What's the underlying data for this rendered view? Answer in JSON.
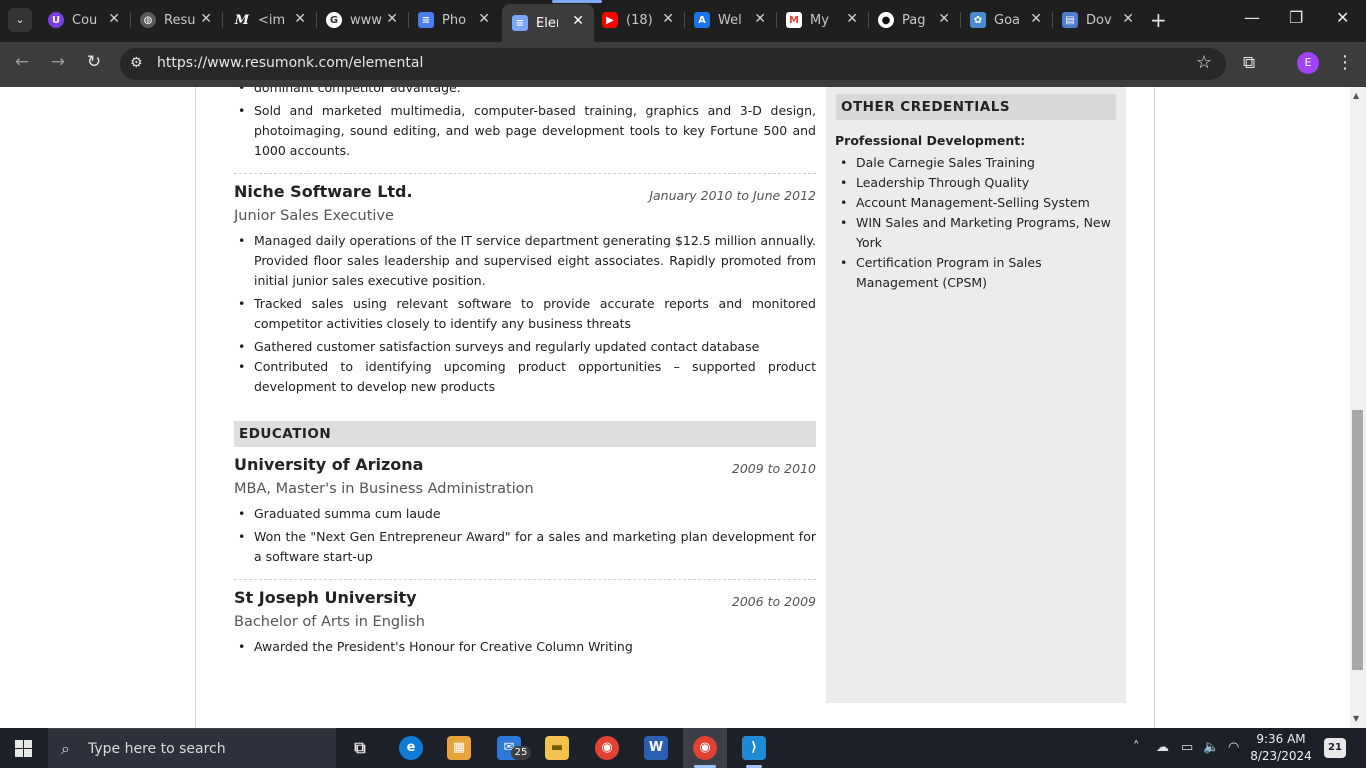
{
  "browser": {
    "tabs": [
      {
        "title": "Cou",
        "icon": "undergrad-icon",
        "color": "#7b3fe4"
      },
      {
        "title": "Resu",
        "icon": "globe-icon",
        "color": "#606060"
      },
      {
        "title": "<im",
        "icon": "medium-icon",
        "color": "#202020"
      },
      {
        "title": "www",
        "icon": "google-icon",
        "color": "#ffffff"
      },
      {
        "title": "Pho",
        "icon": "docs-icon",
        "color": "#4a7df0"
      },
      {
        "title": "Elen",
        "icon": "docs-icon",
        "color": "#7aa6ff"
      },
      {
        "title": "(18)",
        "icon": "youtube-icon",
        "color": "#ff0000"
      },
      {
        "title": "Wel",
        "icon": "docs-a-icon",
        "color": "#1a73e8"
      },
      {
        "title": "My",
        "icon": "gmail-icon",
        "color": "#ea4335"
      },
      {
        "title": "Pag",
        "icon": "github-icon",
        "color": "#ffffff"
      },
      {
        "title": "Goa",
        "icon": "goa-icon",
        "color": "#4a8ad0"
      },
      {
        "title": "Dov",
        "icon": "notepad-icon",
        "color": "#4f7ecf"
      }
    ],
    "active_tab_index": 5,
    "url": "https://www.resumonk.com/elemental",
    "profile_initial": "E"
  },
  "resume": {
    "prev_job": {
      "partial_bullet": "dominant competitor advantage.",
      "bullet": "Sold and marketed multimedia, computer-based training, graphics and 3-D design, photoimaging, sound editing, and web page development tools to key Fortune 500 and 1000 accounts."
    },
    "niche": {
      "org": "Niche Software Ltd.",
      "dates": "January 2010 to June 2012",
      "role": "Junior Sales Executive",
      "bullets": [
        "Managed daily operations of the IT service department generating $12.5 million annually. Provided floor sales leadership and supervised eight associates. Rapidly promoted from initial junior sales executive position.",
        "Tracked sales using relevant software to provide accurate reports and monitored competitor activities closely to identify any business threats",
        "Gathered customer satisfaction surveys and regularly updated contact database",
        "Contributed to identifying upcoming product opportunities – supported product development to develop new products"
      ]
    },
    "education_title": "EDUCATION",
    "arizona": {
      "org": "University of Arizona",
      "dates": "2009 to 2010",
      "role": "MBA, Master's in Business Administration",
      "bullets": [
        "Graduated summa cum laude",
        "Won the \"Next Gen Entrepreneur Award\" for a sales and marketing plan development for a software start-up"
      ]
    },
    "stjoseph": {
      "org": "St Joseph University",
      "dates": "2006 to 2009",
      "role": "Bachelor of Arts in English",
      "bullets": [
        "Awarded the President's Honour for Creative Column Writing"
      ]
    },
    "credentials": {
      "title": "OTHER CREDENTIALS",
      "subtitle": "Professional Development:",
      "items": [
        "Dale Carnegie Sales Training",
        "Leadership Through Quality",
        "Account Management-Selling System",
        "WIN Sales and Marketing Programs, New York",
        "Certification Program in Sales Management (CPSM)"
      ]
    }
  },
  "taskbar": {
    "search_placeholder": "Type here to search",
    "mail_badge": "25",
    "time": "9:36 AM",
    "date": "8/23/2024",
    "notifications": "21"
  }
}
